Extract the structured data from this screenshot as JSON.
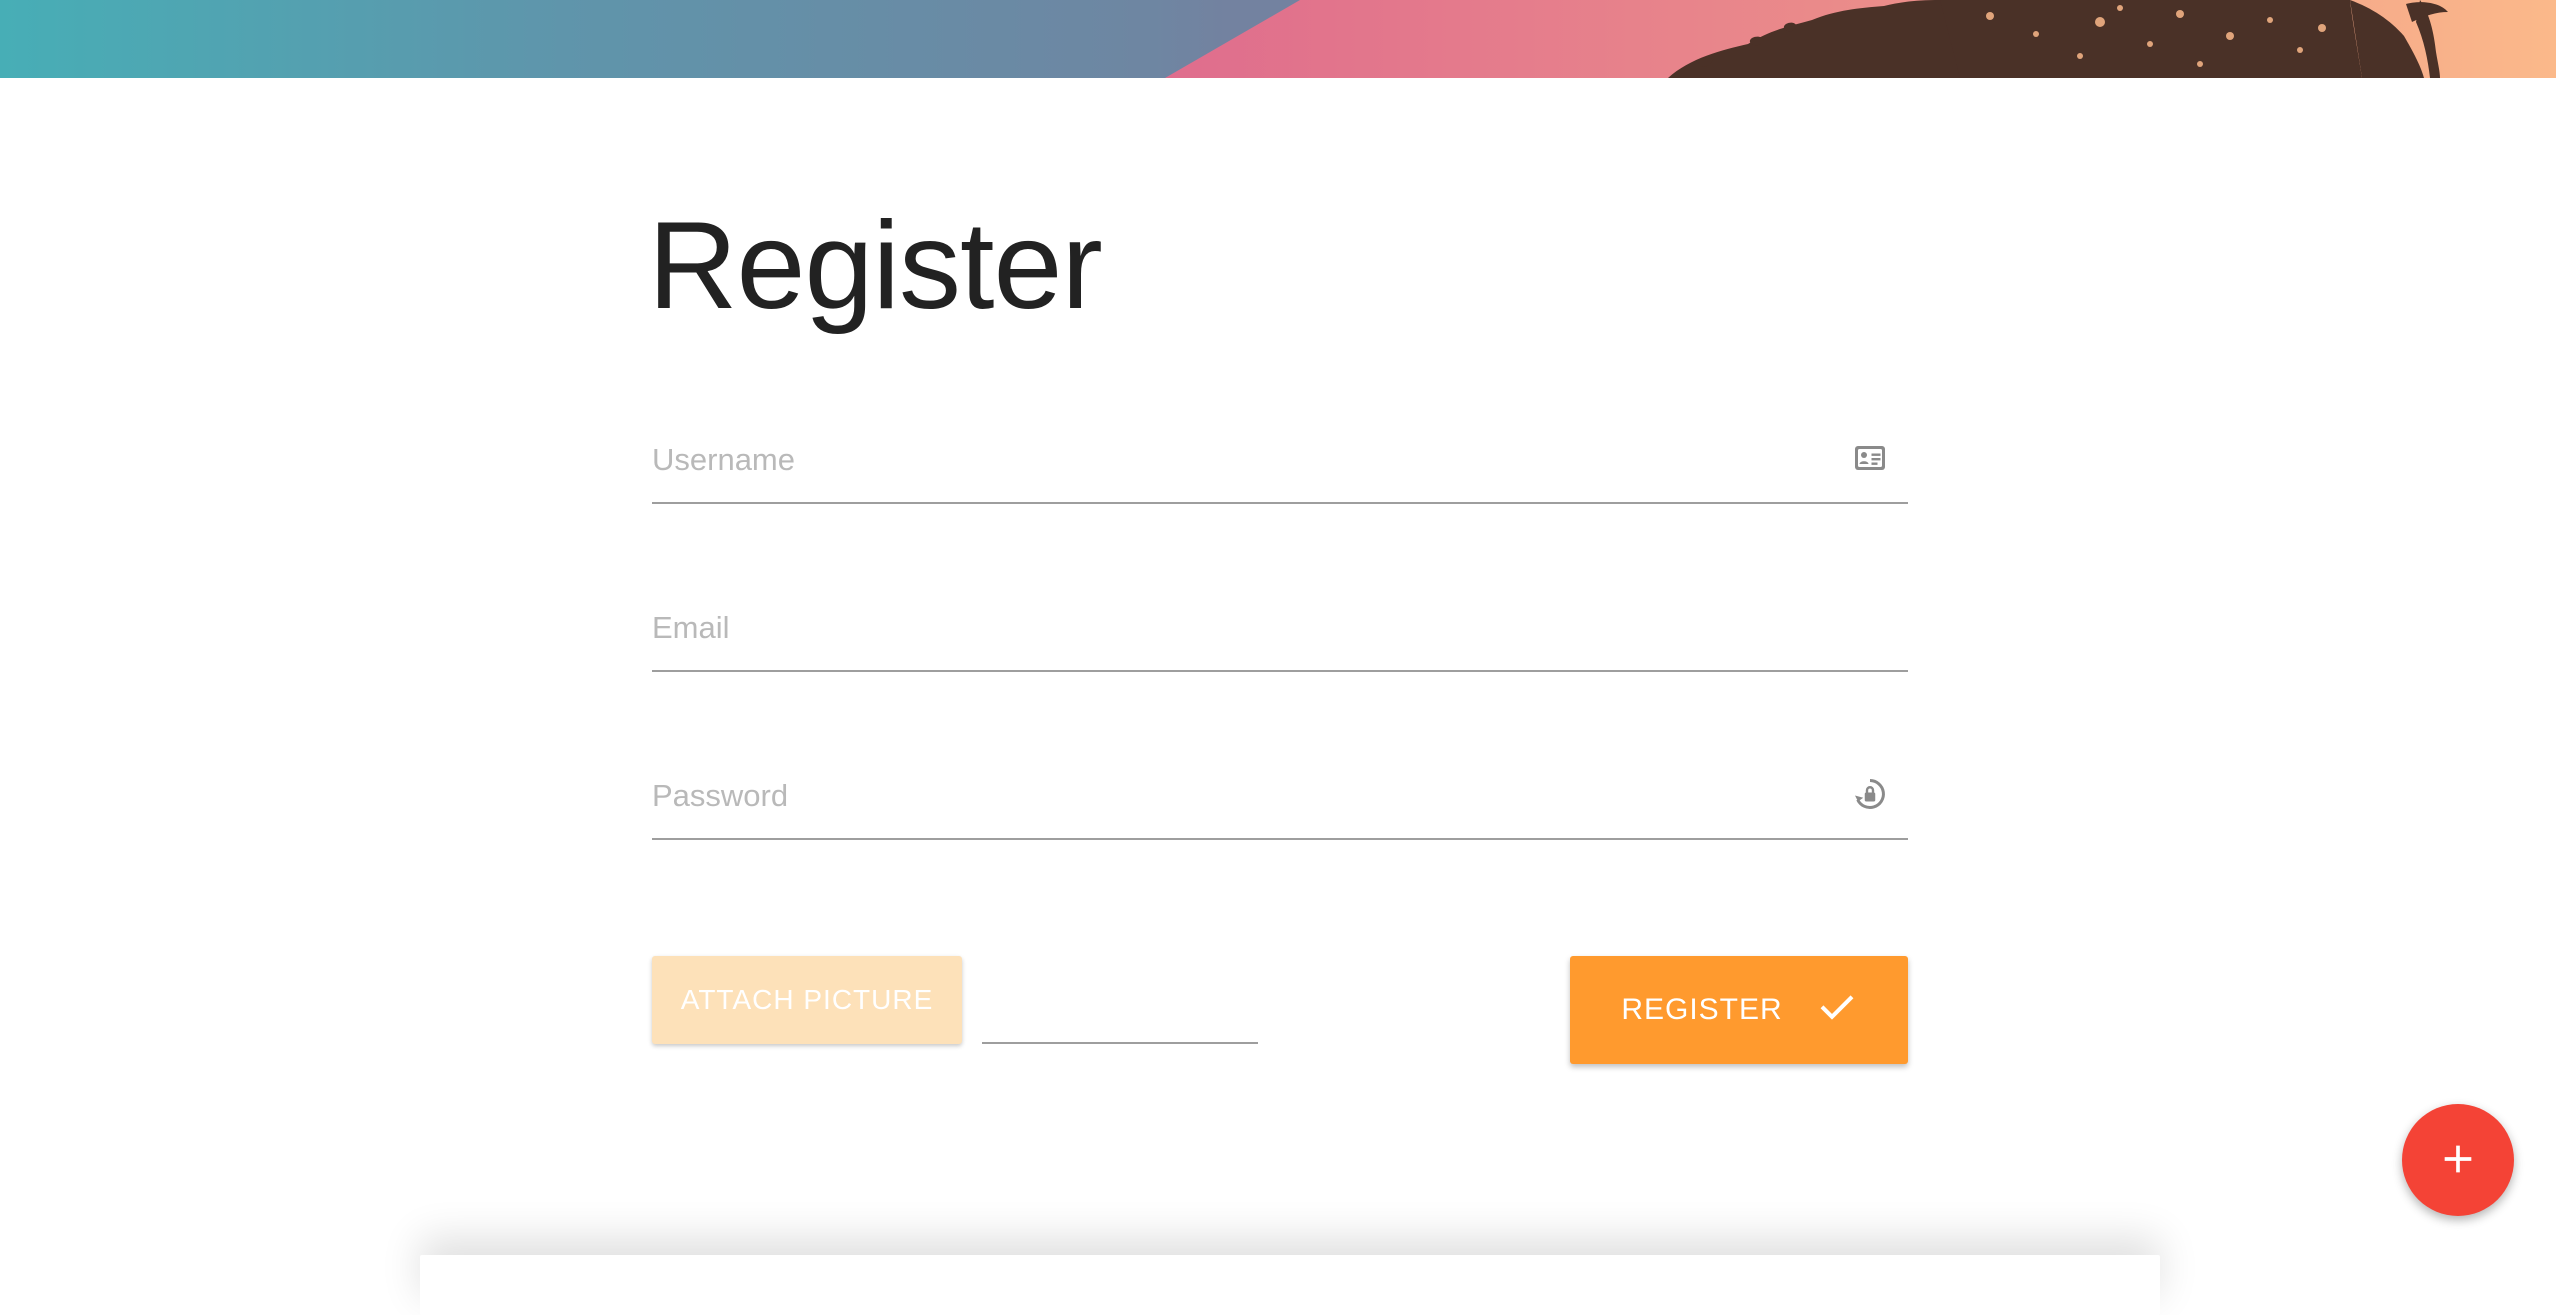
{
  "page": {
    "title": "Register"
  },
  "form": {
    "username": {
      "value": "",
      "placeholder": "Username",
      "icon": "id-card-icon"
    },
    "email": {
      "value": "",
      "placeholder": "Email"
    },
    "password": {
      "value": "",
      "placeholder": "Password",
      "icon": "lock-reset-icon"
    }
  },
  "actions": {
    "attach_label": "ATTACH PICTURE",
    "register_label": "REGISTER",
    "register_icon": "check-icon",
    "fab_icon": "plus-icon"
  },
  "colors": {
    "accent": "#ff9a2e",
    "attach_disabled": "#fde1b9",
    "fab": "#f44336",
    "banner_teal": "#47aeb6",
    "banner_pink": "#e0708e",
    "banner_peach": "#fbb88a",
    "banner_silhouette": "#4a3127"
  }
}
